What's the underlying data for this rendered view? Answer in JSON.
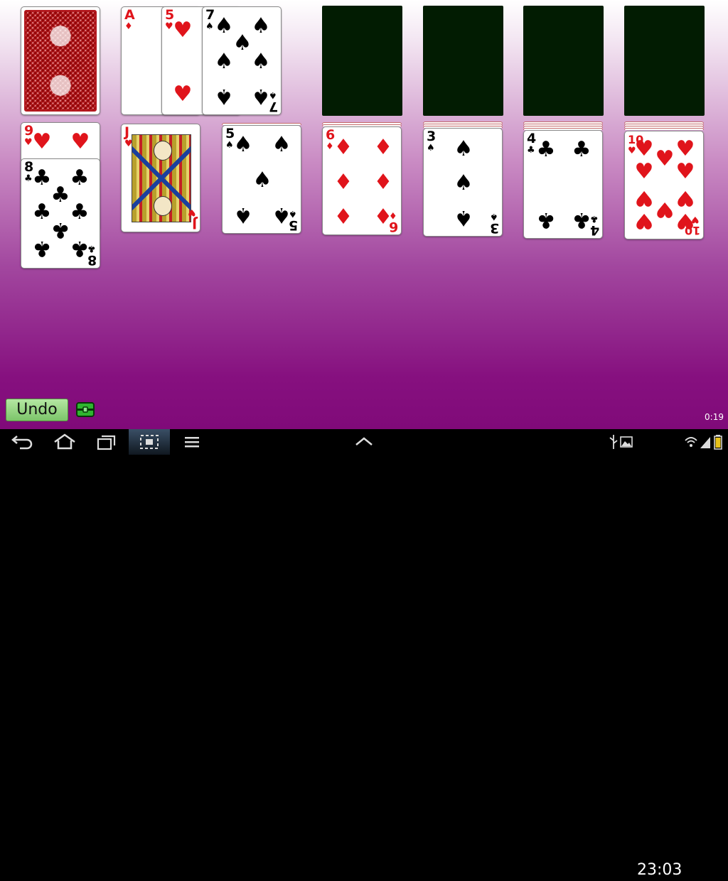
{
  "game": {
    "stock": {
      "face": "down"
    },
    "waste": [
      {
        "rank": "A",
        "suit": "♦",
        "color": "red"
      },
      {
        "rank": "5",
        "suit": "♥",
        "color": "red"
      },
      {
        "rank": "7",
        "suit": "♠",
        "color": "black"
      }
    ],
    "tableau": [
      {
        "buried": {
          "rank": "9",
          "suit": "♥",
          "color": "red"
        },
        "top": {
          "rank": "8",
          "suit": "♣",
          "color": "black"
        }
      },
      {
        "top": {
          "rank": "J",
          "suit": "♥",
          "color": "red"
        }
      },
      {
        "top": {
          "rank": "5",
          "suit": "♠",
          "color": "black"
        }
      },
      {
        "top": {
          "rank": "6",
          "suit": "♦",
          "color": "red"
        }
      },
      {
        "top": {
          "rank": "3",
          "suit": "♠",
          "color": "black"
        }
      },
      {
        "top": {
          "rank": "4",
          "suit": "♣",
          "color": "black"
        }
      },
      {
        "top": {
          "rank": "10",
          "suit": "♥",
          "color": "red"
        }
      }
    ]
  },
  "controls": {
    "undo_label": "Undo",
    "timer": "0:19"
  },
  "statusbar": {
    "clock": "23:03"
  },
  "icons": [
    "back-icon",
    "home-icon",
    "recent-apps-icon",
    "screenshot-icon",
    "menu-icon",
    "up-chevron-icon",
    "usb-icon",
    "image-icon",
    "wifi-icon",
    "signal-icon",
    "battery-icon",
    "chest-icon"
  ],
  "colors": {
    "foundation": "#021c02",
    "undo_button": "#8fd07a",
    "felt_bottom": "#800a79"
  }
}
